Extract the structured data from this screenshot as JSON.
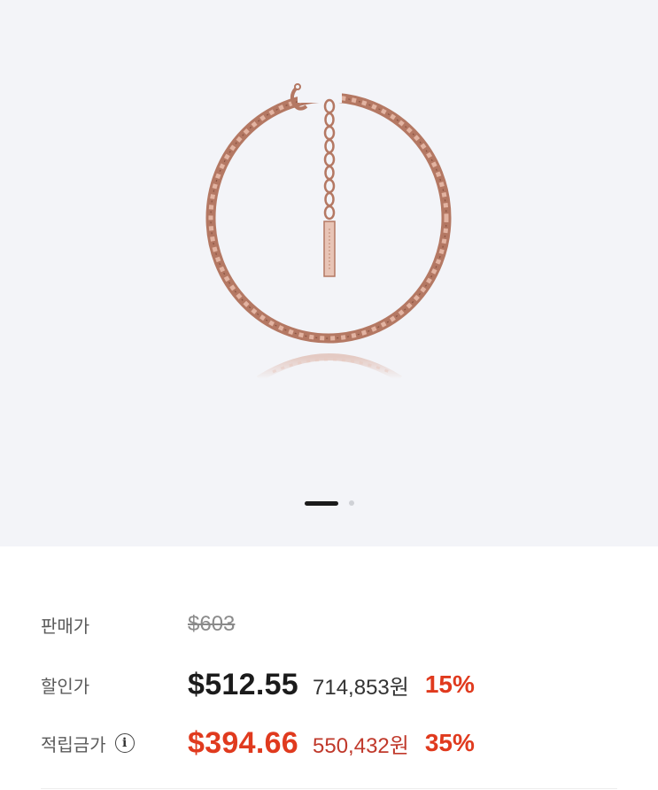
{
  "pricing": {
    "sale_price": {
      "label": "판매가",
      "value": "$603"
    },
    "discount_price": {
      "label": "할인가",
      "value": "$512.55",
      "krw": "714,853원",
      "percent": "15%"
    },
    "reward_price": {
      "label": "적립금가",
      "info_icon": "i",
      "value": "$394.66",
      "krw": "550,432원",
      "percent": "35%"
    }
  },
  "gallery": {
    "image": "rose-gold-rope-chain-bracelet",
    "pages": 2,
    "current_page": 1
  },
  "colors": {
    "accent_red": "#e03a1e",
    "dark_text": "#1b1b1b",
    "rose_gold": "#c98f7a",
    "gallery_bg": "#f3f4f8"
  }
}
